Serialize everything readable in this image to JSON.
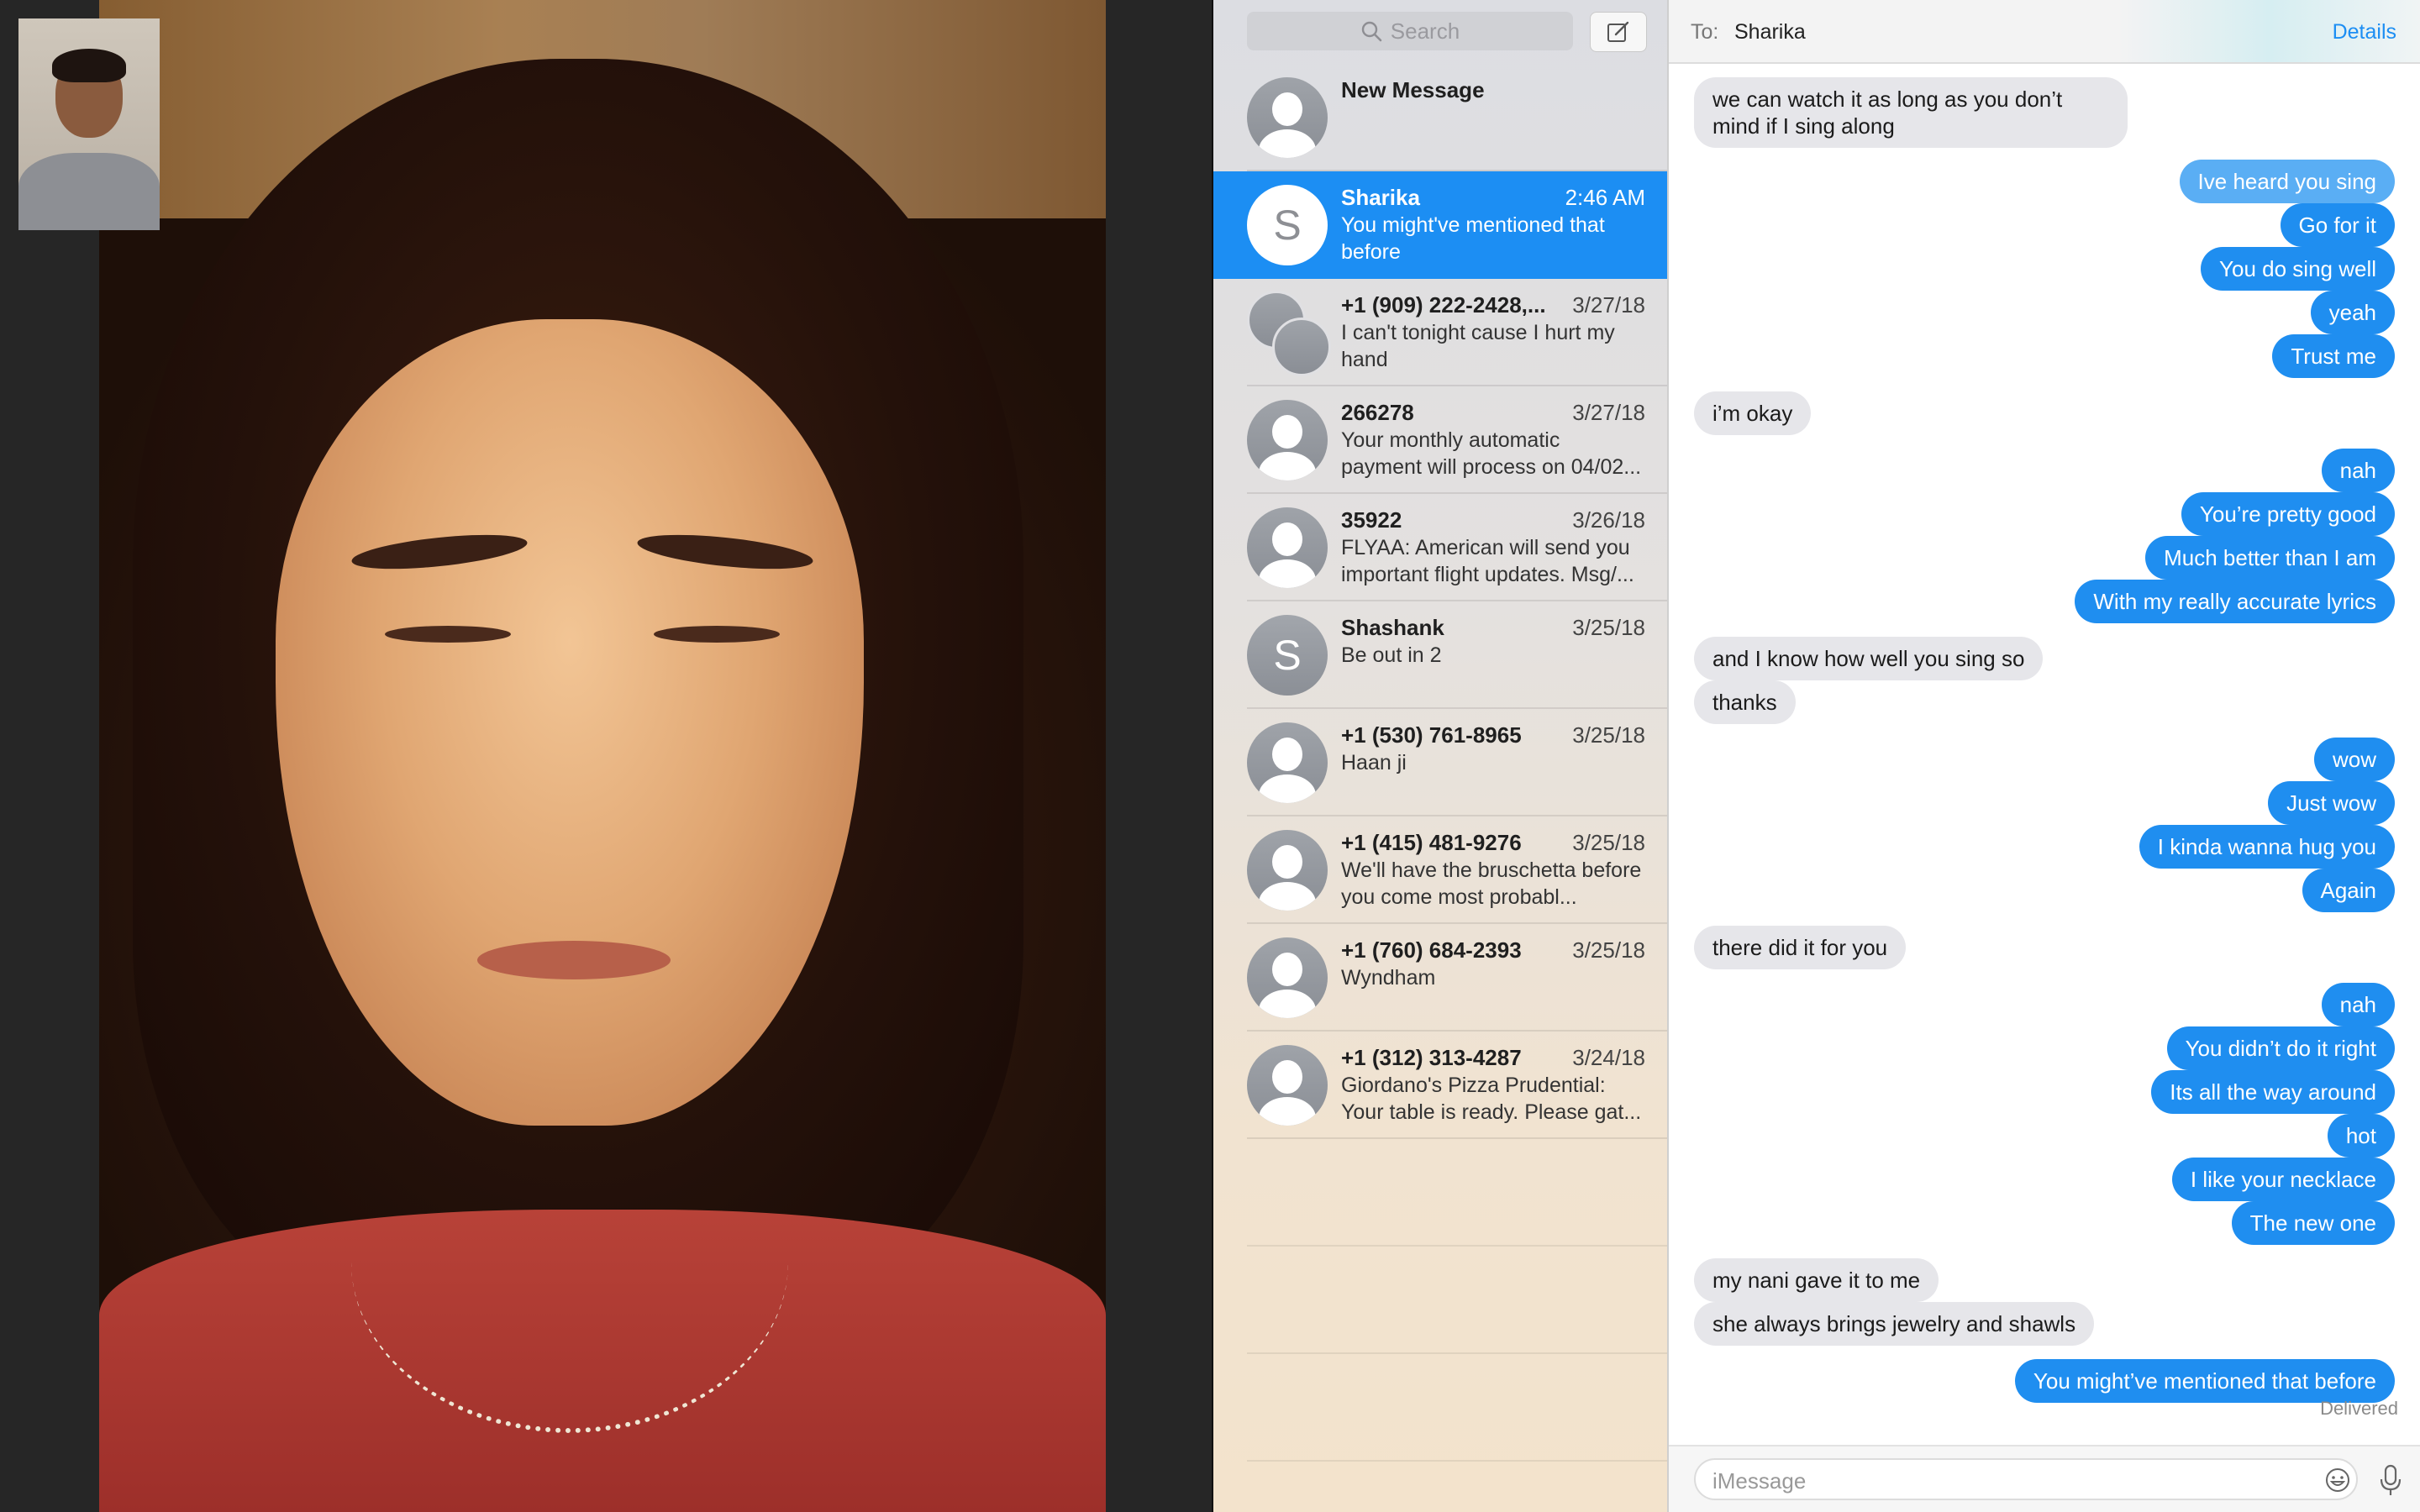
{
  "facetime": {
    "remote_video": "remote-participant-video",
    "local_preview": "self-view-video"
  },
  "sidebar": {
    "search_placeholder": "Search",
    "compose_icon": "compose-icon",
    "conversations": [
      {
        "name": "New Message",
        "date": "",
        "preview": "",
        "avatar": "person",
        "selected": false
      },
      {
        "name": "Sharika",
        "date": "2:46 AM",
        "preview": "You might've mentioned that before",
        "avatar": "S",
        "selected": true
      },
      {
        "name": "+1 (909) 222-2428,...",
        "date": "3/27/18",
        "preview": "I can't tonight cause I hurt my hand",
        "avatar": "group",
        "selected": false
      },
      {
        "name": "266278",
        "date": "3/27/18",
        "preview": "Your monthly automatic payment will process on 04/02...",
        "avatar": "person",
        "selected": false
      },
      {
        "name": "35922",
        "date": "3/26/18",
        "preview": "FLYAA: American will send you important flight updates. Msg/...",
        "avatar": "person",
        "selected": false
      },
      {
        "name": "Shashank",
        "date": "3/25/18",
        "preview": "Be out in 2",
        "avatar": "S",
        "selected": false
      },
      {
        "name": "+1 (530) 761-8965",
        "date": "3/25/18",
        "preview": "Haan ji",
        "avatar": "person",
        "selected": false
      },
      {
        "name": "+1 (415) 481-9276",
        "date": "3/25/18",
        "preview": "We'll have the bruschetta before you come most probabl...",
        "avatar": "person",
        "selected": false
      },
      {
        "name": "+1 (760) 684-2393",
        "date": "3/25/18",
        "preview": "Wyndham",
        "avatar": "person",
        "selected": false
      },
      {
        "name": "+1 (312) 313-4287",
        "date": "3/24/18",
        "preview": "Giordano's Pizza Prudential: Your table is ready. Please gat...",
        "avatar": "person",
        "selected": false
      }
    ]
  },
  "chat": {
    "to_label": "To:",
    "recipient": "Sharika",
    "details_label": "Details",
    "messages": [
      {
        "dir": "in",
        "text": "we can watch it as long as you don’t mind if I sing along"
      },
      {
        "dir": "out",
        "text": "Ive heard you sing"
      },
      {
        "dir": "out",
        "text": "Go for it"
      },
      {
        "dir": "out",
        "text": "You do sing well"
      },
      {
        "dir": "out",
        "text": "yeah"
      },
      {
        "dir": "out",
        "text": "Trust me"
      },
      {
        "dir": "in",
        "text": "i’m okay"
      },
      {
        "dir": "out",
        "text": "nah"
      },
      {
        "dir": "out",
        "text": "You’re pretty good"
      },
      {
        "dir": "out",
        "text": "Much better than I am"
      },
      {
        "dir": "out",
        "text": "With my really accurate lyrics"
      },
      {
        "dir": "in",
        "text": "and I know how well you sing so"
      },
      {
        "dir": "in",
        "text": "thanks"
      },
      {
        "dir": "out",
        "text": "wow"
      },
      {
        "dir": "out",
        "text": "Just wow"
      },
      {
        "dir": "out",
        "text": "I kinda wanna hug you"
      },
      {
        "dir": "out",
        "text": "Again"
      },
      {
        "dir": "in",
        "text": "there did it for you"
      },
      {
        "dir": "out",
        "text": "nah"
      },
      {
        "dir": "out",
        "text": "You didn’t do it right"
      },
      {
        "dir": "out",
        "text": "Its all the way around"
      },
      {
        "dir": "out",
        "text": "hot"
      },
      {
        "dir": "out",
        "text": "I like your necklace"
      },
      {
        "dir": "out",
        "text": "The new one"
      },
      {
        "dir": "in",
        "text": "my nani gave it to me"
      },
      {
        "dir": "in",
        "text": "she always brings jewelry and shawls"
      },
      {
        "dir": "out",
        "text": "You might’ve mentioned that before"
      }
    ],
    "delivered_label": "Delivered",
    "composer_placeholder": "iMessage",
    "emoji_icon": "emoji-icon",
    "mic_icon": "microphone-icon"
  },
  "colors": {
    "accent": "#1c8ef3",
    "outgoing_bubble": "#1f8ef0",
    "incoming_bubble": "#e6e6ea"
  }
}
